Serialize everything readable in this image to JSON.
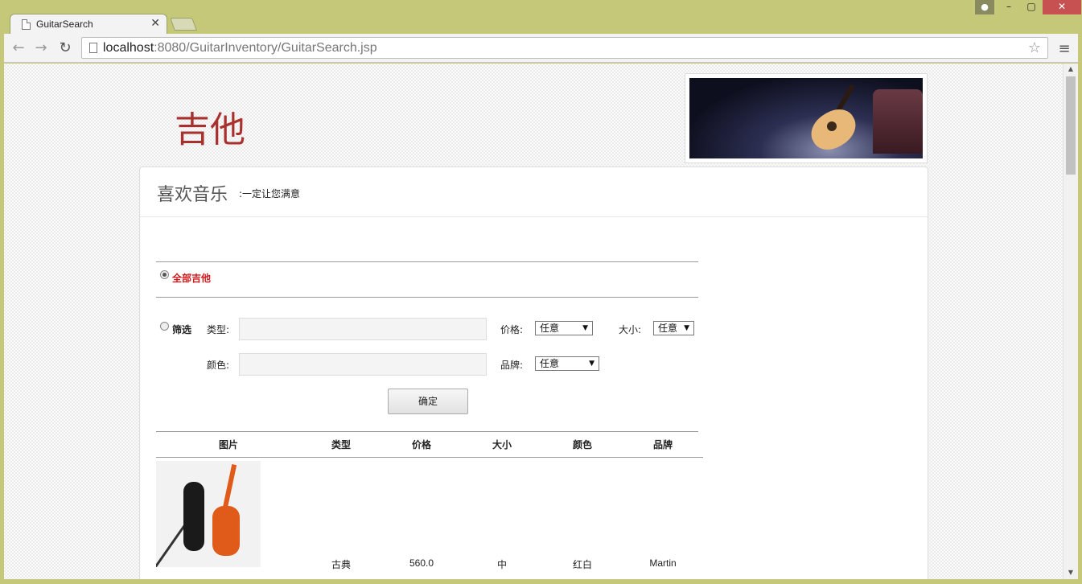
{
  "browser": {
    "tab_title": "GuitarSearch",
    "url_host": "localhost",
    "url_path": ":8080/GuitarInventory/GuitarSearch.jsp"
  },
  "page": {
    "logo_text": "吉他",
    "panel_title": "喜欢音乐",
    "panel_subtitle": ":一定让您满意"
  },
  "form": {
    "all_label": "全部吉他",
    "all_selected": true,
    "filter_label": "筛选",
    "type_label": "类型:",
    "type_value": "",
    "color_label": "颜色:",
    "color_value": "",
    "price_label": "价格:",
    "price_value": "任意",
    "size_label": "大小:",
    "size_value": "任意",
    "brand_label": "品牌:",
    "brand_value": "任意",
    "submit_label": "确定"
  },
  "table": {
    "headers": [
      "图片",
      "类型",
      "价格",
      "大小",
      "颜色",
      "品牌"
    ],
    "rows": [
      {
        "type": "古典",
        "price": "560.0",
        "size": "中",
        "color": "红白",
        "brand": "Martin"
      }
    ]
  }
}
